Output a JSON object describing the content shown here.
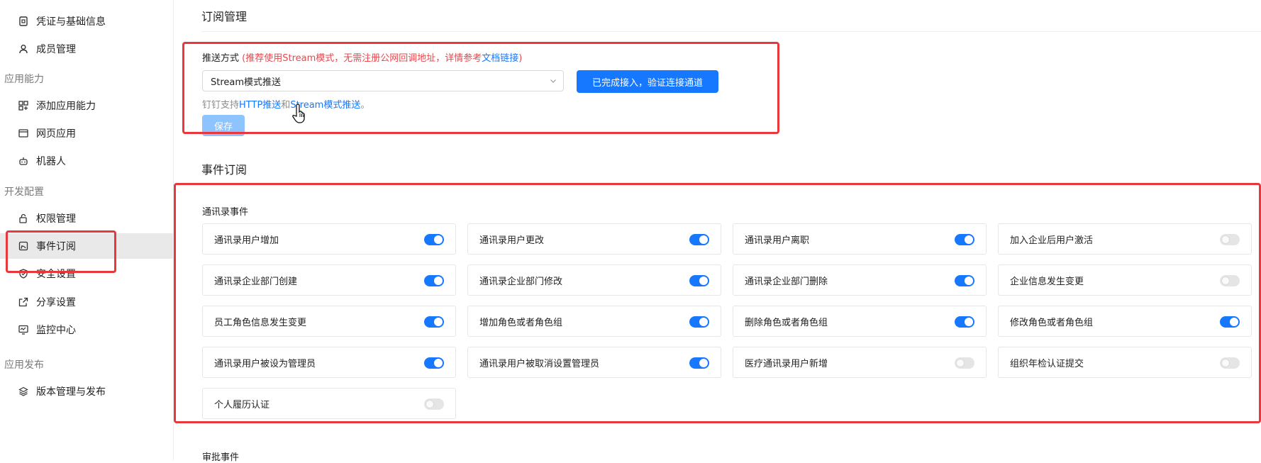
{
  "sidebar": {
    "items": [
      {
        "label": "凭证与基础信息",
        "icon": "credential-icon"
      },
      {
        "label": "成员管理",
        "icon": "user-icon"
      },
      {
        "label": "添加应用能力",
        "icon": "apps-grid-icon"
      },
      {
        "label": "网页应用",
        "icon": "browser-icon"
      },
      {
        "label": "机器人",
        "icon": "robot-icon"
      },
      {
        "label": "权限管理",
        "icon": "lock-icon"
      },
      {
        "label": "事件订阅",
        "icon": "subscription-icon",
        "active": true
      },
      {
        "label": "安全设置",
        "icon": "shield-icon"
      },
      {
        "label": "分享设置",
        "icon": "share-icon"
      },
      {
        "label": "监控中心",
        "icon": "monitor-icon"
      },
      {
        "label": "版本管理与发布",
        "icon": "layers-icon"
      }
    ],
    "groups": [
      "应用能力",
      "开发配置",
      "应用发布"
    ]
  },
  "subscription": {
    "title": "订阅管理",
    "push_label": "推送方式",
    "push_hint_prefix": "(推荐使用Stream模式，无需注册公网回调地址，详情参考",
    "push_hint_link": "文档链接",
    "push_hint_suffix": ")",
    "select_value": "Stream模式推送",
    "verify_button": "已完成接入，验证连接通道",
    "support_prefix": "钉钉支持",
    "support_link1": "HTTP推送",
    "support_mid": "和",
    "support_link2": "Stream模式推送",
    "support_suffix": "。",
    "save_button": "保存"
  },
  "events": {
    "title": "事件订阅",
    "group_title": "通讯录事件",
    "items": [
      {
        "label": "通讯录用户增加",
        "on": true
      },
      {
        "label": "通讯录用户更改",
        "on": true
      },
      {
        "label": "通讯录用户离职",
        "on": true
      },
      {
        "label": "加入企业后用户激活",
        "on": false
      },
      {
        "label": "通讯录企业部门创建",
        "on": true
      },
      {
        "label": "通讯录企业部门修改",
        "on": true
      },
      {
        "label": "通讯录企业部门删除",
        "on": true
      },
      {
        "label": "企业信息发生变更",
        "on": false
      },
      {
        "label": "员工角色信息发生变更",
        "on": true
      },
      {
        "label": "增加角色或者角色组",
        "on": true
      },
      {
        "label": "删除角色或者角色组",
        "on": true
      },
      {
        "label": "修改角色或者角色组",
        "on": true
      },
      {
        "label": "通讯录用户被设为管理员",
        "on": true
      },
      {
        "label": "通讯录用户被取消设置管理员",
        "on": true
      },
      {
        "label": "医疗通讯录用户新增",
        "on": false
      },
      {
        "label": "组织年检认证提交",
        "on": false
      },
      {
        "label": "个人履历认证",
        "on": false
      }
    ],
    "next_group_title": "审批事件"
  },
  "colors": {
    "accent": "#1677ff",
    "highlight": "#e8383d",
    "hint": "#e5484d"
  }
}
